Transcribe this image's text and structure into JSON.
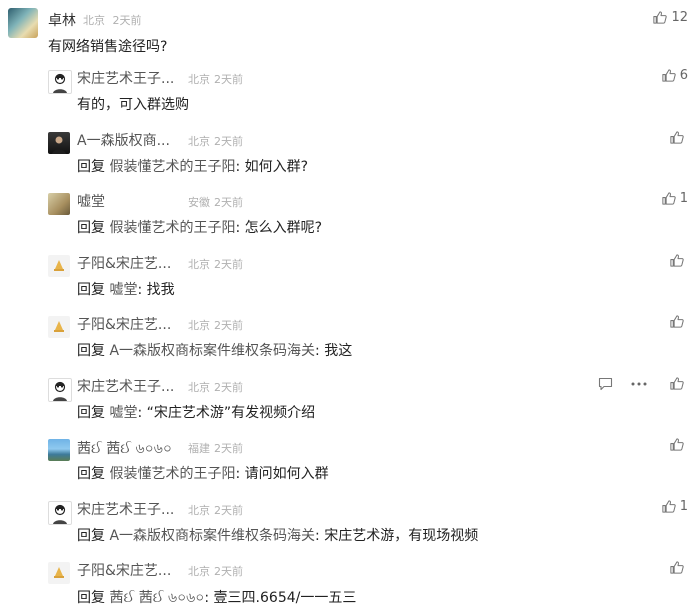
{
  "main_comment": {
    "name": "卓林",
    "location": "北京",
    "time": "2天前",
    "text": "有网络销售途径吗?",
    "likes": "12",
    "avatar_icon": "avatar-landscape"
  },
  "replies": [
    {
      "name": "宋庄艺术王子...",
      "location": "北京",
      "time": "2天前",
      "prefix": "",
      "target": "",
      "text": "有的，可入群选购",
      "likes": "6",
      "avatar_icon": "avatar-cartoon-man"
    },
    {
      "name": "A一森版权商...",
      "location": "北京",
      "time": "2天前",
      "prefix": "回复",
      "target": "假装懂艺术的王子阳",
      "text": ": 如何入群?",
      "likes": "",
      "avatar_icon": "avatar-photo-person"
    },
    {
      "name": "嘘堂",
      "location": "安徽",
      "time": "2天前",
      "prefix": "回复",
      "target": "假装懂艺术的王子阳",
      "text": ": 怎么入群呢?",
      "likes": "1",
      "avatar_icon": "avatar-art"
    },
    {
      "name": "子阳&宋庄艺...",
      "location": "北京",
      "time": "2天前",
      "prefix": "回复",
      "target": "嘘堂",
      "text": ": 找我",
      "likes": "",
      "avatar_icon": "avatar-default"
    },
    {
      "name": "子阳&宋庄艺...",
      "location": "北京",
      "time": "2天前",
      "prefix": "回复",
      "target": "A一森版权商标案件维权条码海关",
      "text": ": 我这",
      "likes": "",
      "avatar_icon": "avatar-default"
    },
    {
      "name": "宋庄艺术王子...",
      "location": "北京",
      "time": "2天前",
      "prefix": "回复",
      "target": "嘘堂",
      "text": ": “宋庄艺术游”有发视频介绍",
      "likes": "",
      "avatar_icon": "avatar-cartoon-man",
      "extra_icons": [
        "comment-icon",
        "more-icon"
      ]
    },
    {
      "name": "茜ઈ 茜ઈ ৬০৬০",
      "location": "福建",
      "time": "2天前",
      "prefix": "回复",
      "target": "假装懂艺术的王子阳",
      "text": ": 请问如何入群",
      "likes": "",
      "avatar_icon": "avatar-lake"
    },
    {
      "name": "宋庄艺术王子...",
      "location": "北京",
      "time": "2天前",
      "prefix": "回复",
      "target": "A一森版权商标案件维权条码海关",
      "text": ": 宋庄艺术游，有现场视频",
      "likes": "1",
      "avatar_icon": "avatar-cartoon-man"
    },
    {
      "name": "子阳&宋庄艺...",
      "location": "北京",
      "time": "2天前",
      "prefix": "回复",
      "target": "茜ઈ 茜ઈ ৬০৬০",
      "text": ": 壹三四.6654/一一五三",
      "likes": "",
      "avatar_icon": "avatar-default"
    }
  ]
}
